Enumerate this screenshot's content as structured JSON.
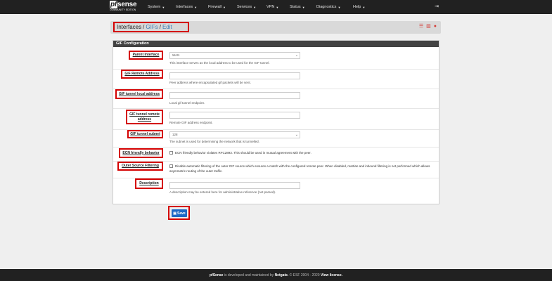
{
  "logo": {
    "brand": "pfsense",
    "edition": "COMMUNITY EDITION"
  },
  "nav": {
    "items": [
      "System",
      "Interfaces",
      "Firewall",
      "Services",
      "VPN",
      "Status",
      "Diagnostics",
      "Help"
    ],
    "logout_icon": "sign-out-icon"
  },
  "breadcrumb": {
    "root": "Interfaces",
    "sep1": "/",
    "level2": "GIFs",
    "sep2": "/",
    "level3": "Edit"
  },
  "panel": {
    "title": "GIF Configuration"
  },
  "fields": {
    "parent_interface": {
      "label": "Parent Interface",
      "value": "WAN",
      "help": "This interface serves as the local address to be used for the GIF tunnel."
    },
    "remote_address": {
      "label": "GIF Remote Address",
      "value": "",
      "help": "Peer address where encapsulated gif packets will be sent."
    },
    "local_address": {
      "label": "GIF tunnel local address",
      "value": "",
      "help": "Local gif tunnel endpoint."
    },
    "remote_tunnel": {
      "label": "GIF tunnel remote address",
      "value": "",
      "help": "Remote GIF address endpoint."
    },
    "subnet": {
      "label": "GIF tunnel subnet",
      "value": "128",
      "help": "The subnet is used for determining the network that is tunnelled."
    },
    "ecn": {
      "label": "ECN friendly behavior",
      "text": "ECN friendly behavior violates RFC2893. This should be used in mutual agreement with the peer."
    },
    "outer_filter": {
      "label": "Outer Source Filtering",
      "text": "Disable automatic filtering of the outer GIF source which ensures a match with the configured remote peer. When disabled, martian and inbound filtering is not performed which allows asymmetric routing of the outer traffic."
    },
    "description": {
      "label": "Description",
      "value": "",
      "help": "A description may be entered here for administrative reference (not parsed)."
    }
  },
  "save": {
    "label": "Save"
  },
  "footer": {
    "brand": "pfSense",
    "text1": " is developed and maintained by ",
    "company": "Netgate.",
    "text2": " © ESF 2004 - 2020 ",
    "license": "View license."
  },
  "colors": {
    "navbar": "#212121",
    "highlight": "#d40000",
    "save_button": "#1e6ac6",
    "link": "#3a7fb7"
  }
}
